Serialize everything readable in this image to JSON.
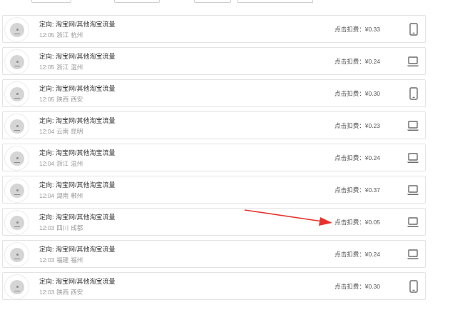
{
  "colors": {
    "border": "#e3e3e3",
    "title_text": "#333333",
    "meta_text": "#999999",
    "arrow": "#e8312b"
  },
  "records": [
    {
      "title": "定向: 淘宝网/其他淘宝流量",
      "time": "12:05",
      "province": "浙江",
      "city": "杭州",
      "cost": "点击扣费：¥0.33",
      "device": "phone-icon"
    },
    {
      "title": "定向: 淘宝网/其他淘宝流量",
      "time": "12:05",
      "province": "浙江",
      "city": "温州",
      "cost": "点击扣费：¥0.24",
      "device": "laptop-icon"
    },
    {
      "title": "定向: 淘宝网/其他淘宝流量",
      "time": "12:05",
      "province": "陕西",
      "city": "西安",
      "cost": "点击扣费：¥0.30",
      "device": "phone-icon"
    },
    {
      "title": "定向: 淘宝网/其他淘宝流量",
      "time": "12:04",
      "province": "云南",
      "city": "昆明",
      "cost": "点击扣费：¥0.23",
      "device": "laptop-icon"
    },
    {
      "title": "定向: 淘宝网/其他淘宝流量",
      "time": "12:04",
      "province": "浙江",
      "city": "温州",
      "cost": "点击扣费：¥0.24",
      "device": "laptop-icon"
    },
    {
      "title": "定向: 淘宝网/其他淘宝流量",
      "time": "12:04",
      "province": "湖南",
      "city": "郴州",
      "cost": "点击扣费：¥0.37",
      "device": "laptop-icon"
    },
    {
      "title": "定向: 淘宝网/其他淘宝流量",
      "time": "12:03",
      "province": "四川",
      "city": "成都",
      "cost": "点击扣费：¥0.05",
      "device": "laptop-icon"
    },
    {
      "title": "定向: 淘宝网/其他淘宝流量",
      "time": "12:03",
      "province": "福建",
      "city": "福州",
      "cost": "点击扣费：¥0.24",
      "device": "laptop-icon"
    },
    {
      "title": "定向: 淘宝网/其他淘宝流量",
      "time": "12:03",
      "province": "陕西",
      "city": "西安",
      "cost": "点击扣费：¥0.30",
      "device": "phone-icon"
    }
  ]
}
